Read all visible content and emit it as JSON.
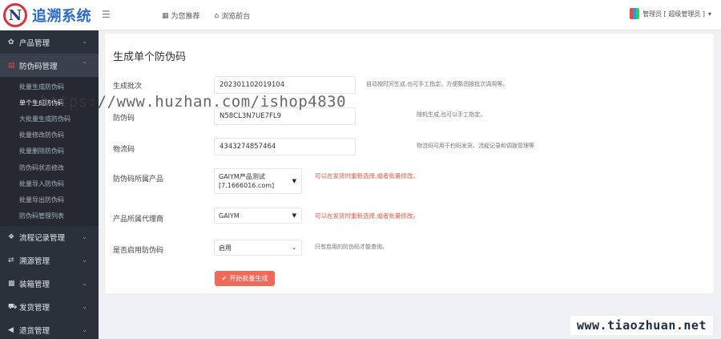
{
  "app": {
    "logo_letter": "N",
    "title": "追溯系统"
  },
  "topnav": [
    {
      "icon": "store-icon",
      "label": "为您推荐"
    },
    {
      "icon": "home-icon",
      "label": "浏览前台"
    }
  ],
  "user": {
    "label": "管理员 [ 超级管理员 ]"
  },
  "sidebar": {
    "items": [
      {
        "label": "产品管理",
        "icon": "leaf-icon",
        "active": false
      },
      {
        "label": "防伪码管理",
        "icon": "barcode-icon",
        "active": true
      },
      {
        "label": "流程记录管理",
        "icon": "tag-icon",
        "active": false
      },
      {
        "label": "溯源管理",
        "icon": "exchange-icon",
        "active": false
      },
      {
        "label": "装箱管理",
        "icon": "grid-icon",
        "active": false
      },
      {
        "label": "发货管理",
        "icon": "truck-icon",
        "active": false
      },
      {
        "label": "退货管理",
        "icon": "return-icon",
        "active": false
      }
    ],
    "submenu": [
      "批量生成防伪码",
      "单个生成防伪码",
      "大批量生成防伪码",
      "批量修改防伪码",
      "批量删除防伪码",
      "防伪码状态修改",
      "批量导入防伪码",
      "批量导出防伪码",
      "防伪码管理列表"
    ],
    "submenu_active_index": 1
  },
  "form": {
    "title": "生成单个防伪码",
    "batch": {
      "label": "生成批次",
      "value": "202301102019104",
      "help": "自动按时间生成,也可手工指定。方便集团按批次调用等。"
    },
    "code": {
      "label": "防伪码",
      "value": "N58CL3N7UE7FL9",
      "help": "随机生成,也可以手工指定。"
    },
    "logistics": {
      "label": "物流码",
      "value": "4343274857464",
      "help": "物流码可用于扫码发货、流程记录和调拨管理等"
    },
    "product": {
      "label": "防伪码所属产品",
      "value": "GAIYM产品测试 [7.1666016.com]",
      "help": "可以在发货时重新选择,或者批量修改。"
    },
    "agent": {
      "label": "产品所属代理商",
      "value": "GAIYM",
      "help": "可以在发货时重新选择,或者批量修改。"
    },
    "enabled": {
      "label": "是否启用防伪码",
      "value": "启用",
      "help": "只有启用的防伪码才能查询。"
    },
    "submit_label": "开始批量生成"
  },
  "watermarks": {
    "url": "https://www.huzhan.com/ishop4830",
    "badge": "www.tiaozhuan.net"
  },
  "colors": {
    "accent": "#ef6a5a",
    "sidebar": "#2b313b",
    "warn_text": "#e8593f"
  }
}
